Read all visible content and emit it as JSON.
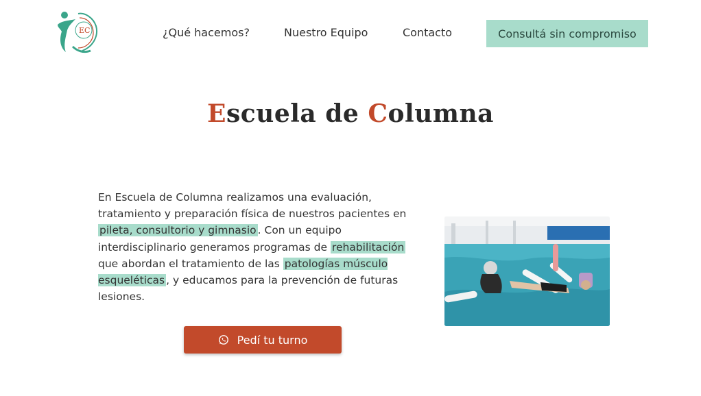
{
  "header": {
    "logo_text": "EC",
    "nav": [
      {
        "label": "¿Qué hacemos?"
      },
      {
        "label": "Nuestro Equipo"
      },
      {
        "label": "Contacto"
      }
    ],
    "cta_label": "Consultá sin compromiso"
  },
  "hero": {
    "title_first_letter": "E",
    "title_part1": "scuela de ",
    "title_second_letter": "C",
    "title_part2": "olumna"
  },
  "intro": {
    "text_1": "En Escuela de Columna realizamos una evaluación, tratamiento y preparación física de nuestros pacientes en ",
    "highlight_1": "pileta, consultorio y gimnasio",
    "text_2": ". Con un equipo interdisciplinario generamos programas de ",
    "highlight_2": "rehabilitación",
    "text_3": " que abordan el tratamiento de las ",
    "highlight_3": "patologías músculo esqueléticas",
    "text_4": ", y educamos para la prevención de futuras lesiones."
  },
  "action": {
    "button_label": "Pedí tu turno",
    "icon": "whatsapp-icon"
  },
  "colors": {
    "accent": "#c24a2b",
    "mint": "#a8dccb",
    "logo_teal": "#3aa58a"
  }
}
